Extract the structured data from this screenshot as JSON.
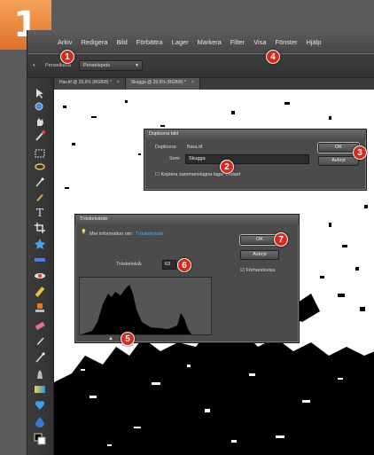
{
  "step_number": "1",
  "menubar": {
    "items": [
      "Arkiv",
      "Redigera",
      "Bild",
      "Förbättra",
      "Lager",
      "Markera",
      "Filter",
      "Visa",
      "Fönster",
      "Hjälp"
    ]
  },
  "options": {
    "label": "Penselkarta",
    "select_value": "Penselspets"
  },
  "tabs": [
    {
      "label": "Hav.tif @ 29,6% (RGB/8) *",
      "close": "×"
    },
    {
      "label": "Skugga @ 29,6% (RGB/8) *",
      "close": "×"
    }
  ],
  "duplicate_dialog": {
    "title": "Duplicera bild",
    "duplicate_label": "Duplicera:",
    "duplicate_value": "Bara.tif",
    "name_label": "Som:",
    "name_value": "Skugga",
    "merge_checkbox": "Kopiera sammanslagna lager endast",
    "ok": "OK",
    "cancel": "Avbryt"
  },
  "threshold_dialog": {
    "title": "Tröskelvärde",
    "info_text": "Mer information om:",
    "info_link": "Tröskelvärde",
    "level_label": "Tröskelnivå:",
    "level_value": "63",
    "ok": "OK",
    "cancel": "Avbryt",
    "preview": "Förhandsvisa"
  },
  "badges": {
    "b1": "1",
    "b2": "2",
    "b3": "3",
    "b4": "4",
    "b5": "5",
    "b6": "6",
    "b7": "7"
  },
  "colors": {
    "badge": "#d62b1e",
    "step_tab": "#e8782e"
  }
}
